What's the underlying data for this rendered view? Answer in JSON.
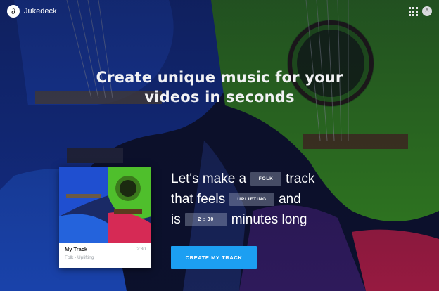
{
  "app": {
    "name": "Jukedeck",
    "logo_glyph": "∂"
  },
  "header": {
    "avatar_initial": "A",
    "apps_icon": "grid-icon"
  },
  "hero": {
    "headline_line1": "Create unique music for your",
    "headline_line2": "videos in seconds"
  },
  "track_card": {
    "name": "My Track",
    "subtitle": "Folk - Uplifting",
    "duration": "2:30"
  },
  "builder": {
    "line1_prefix": "Let's make a",
    "genre": "FOLK",
    "line1_suffix": "track",
    "line2_prefix": "that feels",
    "mood": "UPLIFTING",
    "line2_suffix": "and",
    "line3_prefix": "is",
    "length": "2 : 30",
    "line3_suffix": "minutes long"
  },
  "cta": {
    "label": "CREATE MY TRACK"
  },
  "colors": {
    "accent": "#1c9ff2",
    "overlay": "#0b0f27",
    "guitar_blue": "#1b4fcf",
    "guitar_green": "#4fbf2c"
  }
}
